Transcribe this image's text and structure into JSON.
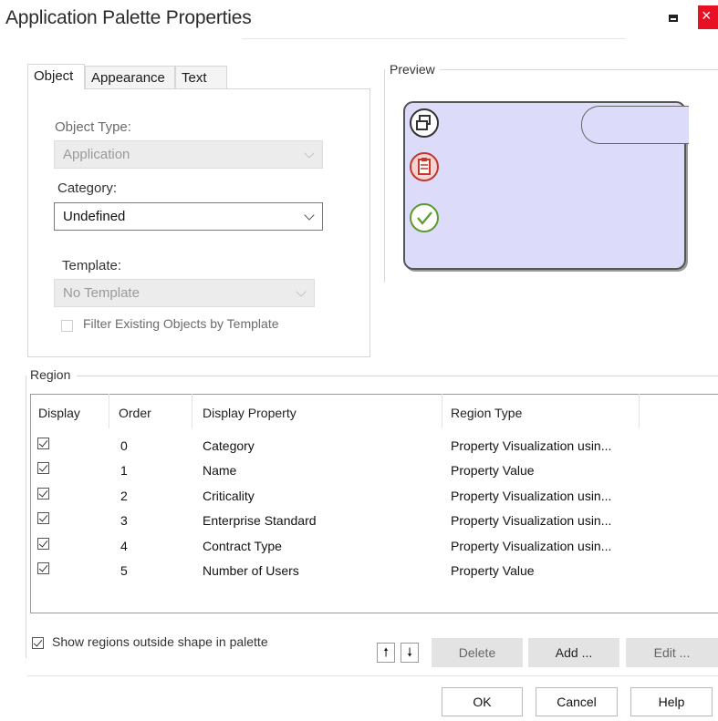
{
  "window": {
    "title": "Application Palette Properties"
  },
  "tabs": [
    {
      "label": "Object",
      "active": true
    },
    {
      "label": "Appearance",
      "active": false
    },
    {
      "label": "Text",
      "active": false
    }
  ],
  "object_tab": {
    "object_type": {
      "label": "Object Type:",
      "value": "Application",
      "enabled": false
    },
    "category": {
      "label": "Category:",
      "value": "Undefined",
      "enabled": true
    },
    "template": {
      "label": "Template:",
      "value": "No Template",
      "enabled": false
    },
    "filter_checkbox": {
      "label": "Filter Existing Objects by Template",
      "checked": false,
      "enabled": false
    }
  },
  "preview": {
    "label": "Preview",
    "shape_fill": "#dcdcfa",
    "icons": [
      "application-icon",
      "clipboard-icon",
      "checkmark-icon"
    ]
  },
  "region": {
    "label": "Region",
    "columns": [
      "Display",
      "Order",
      "Display Property",
      "Region Type"
    ],
    "rows": [
      {
        "display": true,
        "order": "0",
        "property": "Category",
        "type": "Property Visualization usin..."
      },
      {
        "display": true,
        "order": "1",
        "property": "Name",
        "type": "Property Value"
      },
      {
        "display": true,
        "order": "2",
        "property": "Criticality",
        "type": "Property Visualization usin..."
      },
      {
        "display": true,
        "order": "3",
        "property": "Enterprise Standard",
        "type": "Property Visualization usin..."
      },
      {
        "display": true,
        "order": "4",
        "property": "Contract Type",
        "type": "Property Visualization usin..."
      },
      {
        "display": true,
        "order": "5",
        "property": "Number of Users",
        "type": "Property Value"
      }
    ],
    "show_outside": {
      "label": "Show regions outside shape in palette",
      "checked": true
    },
    "buttons": {
      "up": "🠕",
      "down": "🠗",
      "delete": "Delete",
      "add": "Add ...",
      "edit": "Edit ..."
    }
  },
  "dialog_buttons": {
    "ok": "OK",
    "cancel": "Cancel",
    "help": "Help"
  }
}
